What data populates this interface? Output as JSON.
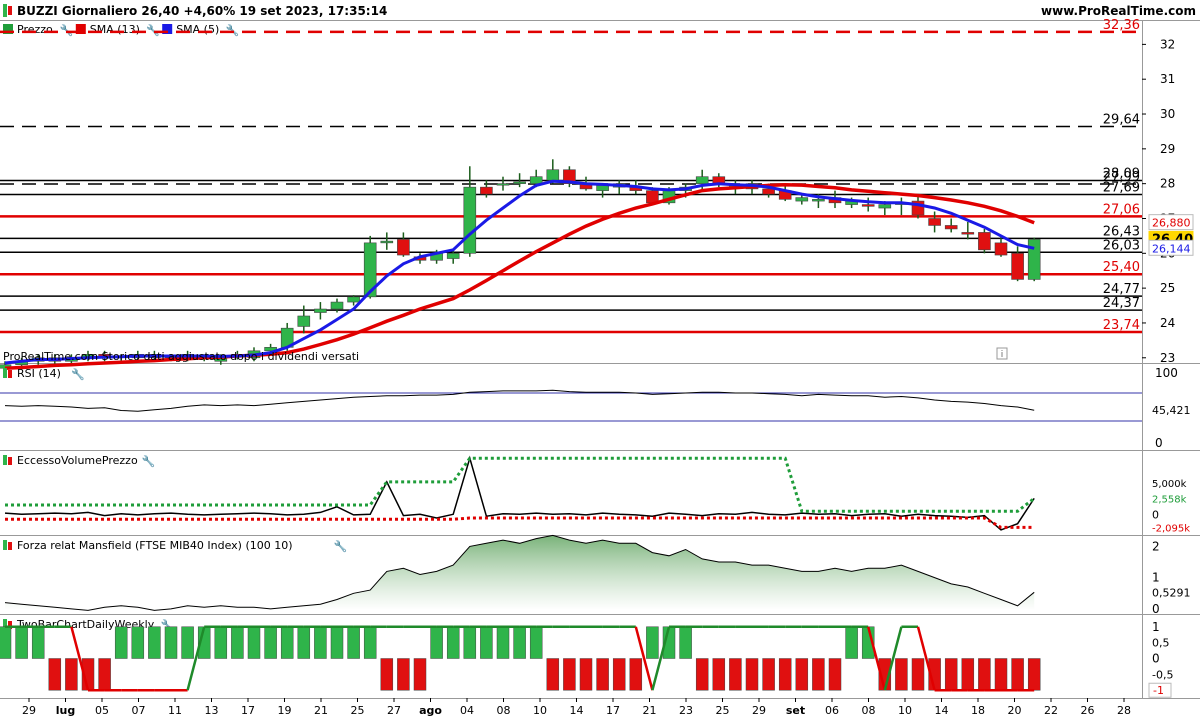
{
  "header": {
    "title": "BUZZI Giornaliero 26,40 +4,60% 19 set 2023, 17:35:14",
    "site": "www.ProRealTime.com"
  },
  "footnote": "ProRealTime.com  Storico dati aggiustato dopo i dividendi versati",
  "legend": [
    {
      "label": "Prezzo",
      "color": "#1f9d3a"
    },
    {
      "label": "SMA (13)",
      "color": "#e00000"
    },
    {
      "label": "SMA (5)",
      "color": "#1a1ae6"
    }
  ],
  "colors": {
    "up": "#2fb44a",
    "down": "#e01010",
    "sma13": "#e00000",
    "sma5": "#1a1ae6",
    "price_badge": "#ffd700"
  },
  "xaxis": {
    "labels": [
      "29",
      "lug",
      "05",
      "07",
      "11",
      "13",
      "17",
      "19",
      "21",
      "25",
      "27",
      "ago",
      "04",
      "08",
      "10",
      "14",
      "17",
      "21",
      "23",
      "25",
      "29",
      "set",
      "06",
      "08",
      "10",
      "14",
      "18",
      "20",
      "22",
      "26",
      "28"
    ]
  },
  "chart_data": [
    {
      "type": "candlestick",
      "title": "Prezzo",
      "ylim": [
        22.85,
        32.7
      ],
      "yticks": [
        23,
        24,
        25,
        26,
        27,
        28,
        29,
        30,
        31,
        32
      ],
      "levels": [
        {
          "value": 32.36,
          "label": "32,36",
          "color": "#e00000",
          "style": "dashed"
        },
        {
          "value": 29.64,
          "label": "29,64",
          "color": "#000000",
          "style": "dashed"
        },
        {
          "value": 28.09,
          "label": "28,09",
          "color": "#000000",
          "style": "solid"
        },
        {
          "value": 27.99,
          "label": "27,99",
          "color": "#000000",
          "style": "dashed"
        },
        {
          "value": 27.69,
          "label": "27,69",
          "color": "#000000",
          "style": "solid"
        },
        {
          "value": 27.06,
          "label": "27,06",
          "color": "#e00000",
          "style": "solid"
        },
        {
          "value": 26.43,
          "label": "26,43",
          "color": "#000000",
          "style": "solid"
        },
        {
          "value": 26.03,
          "label": "26,03",
          "color": "#000000",
          "style": "solid"
        },
        {
          "value": 25.4,
          "label": "25,40",
          "color": "#e00000",
          "style": "solid"
        },
        {
          "value": 24.77,
          "label": "24,77",
          "color": "#000000",
          "style": "solid"
        },
        {
          "value": 24.37,
          "label": "24,37",
          "color": "#000000",
          "style": "solid"
        },
        {
          "value": 23.74,
          "label": "23,74",
          "color": "#e00000",
          "style": "solid"
        }
      ],
      "badges": [
        {
          "value": 26.88,
          "label": "26,880",
          "color": "#e00000",
          "bg": "#ffffff"
        },
        {
          "value": 26.4,
          "label": "26,40",
          "color": "#000000",
          "bg": "#ffd700"
        },
        {
          "value": 26.144,
          "label": "26,144",
          "color": "#1a1ae6",
          "bg": "#ffffff"
        }
      ],
      "ohlc": [
        [
          22.7,
          22.9,
          22.6,
          22.8
        ],
        [
          22.8,
          23.0,
          22.7,
          22.9
        ],
        [
          22.9,
          23.1,
          22.8,
          23.0
        ],
        [
          23.0,
          23.1,
          22.8,
          22.9
        ],
        [
          22.9,
          23.1,
          22.8,
          23.0
        ],
        [
          23.0,
          23.2,
          22.9,
          23.1
        ],
        [
          23.1,
          23.2,
          22.9,
          23.0
        ],
        [
          23.0,
          23.1,
          22.9,
          23.05
        ],
        [
          23.0,
          23.2,
          22.9,
          23.1
        ],
        [
          23.1,
          23.2,
          22.9,
          23.0
        ],
        [
          23.0,
          23.1,
          22.9,
          23.05
        ],
        [
          23.0,
          23.2,
          22.9,
          23.1
        ],
        [
          23.05,
          23.1,
          22.9,
          23.0
        ],
        [
          22.9,
          23.1,
          22.8,
          23.05
        ],
        [
          23.05,
          23.2,
          22.95,
          23.1
        ],
        [
          23.0,
          23.3,
          22.9,
          23.2
        ],
        [
          23.2,
          23.4,
          23.1,
          23.3
        ],
        [
          23.3,
          24.0,
          23.2,
          23.85
        ],
        [
          23.9,
          24.5,
          23.7,
          24.2
        ],
        [
          24.3,
          24.6,
          24.1,
          24.4
        ],
        [
          24.4,
          24.7,
          24.3,
          24.6
        ],
        [
          24.6,
          24.8,
          24.5,
          24.75
        ],
        [
          24.75,
          26.5,
          24.7,
          26.3
        ],
        [
          26.3,
          26.6,
          26.1,
          26.35
        ],
        [
          26.4,
          26.6,
          25.9,
          25.95
        ],
        [
          25.9,
          26.0,
          25.7,
          25.8
        ],
        [
          25.8,
          26.1,
          25.7,
          26.0
        ],
        [
          25.85,
          26.1,
          25.7,
          26.0
        ],
        [
          26.0,
          28.5,
          25.9,
          27.9
        ],
        [
          27.9,
          28.1,
          27.6,
          27.7
        ],
        [
          28.0,
          28.2,
          27.8,
          28.0
        ],
        [
          28.0,
          28.3,
          27.9,
          28.05
        ],
        [
          28.0,
          28.4,
          27.9,
          28.2
        ],
        [
          28.1,
          28.7,
          28.0,
          28.4
        ],
        [
          28.4,
          28.5,
          27.9,
          28.0
        ],
        [
          28.0,
          28.2,
          27.8,
          27.85
        ],
        [
          27.8,
          28.0,
          27.6,
          27.95
        ],
        [
          27.9,
          28.1,
          27.7,
          28.0
        ],
        [
          27.9,
          28.1,
          27.7,
          27.8
        ],
        [
          27.8,
          27.9,
          27.4,
          27.45
        ],
        [
          27.45,
          27.9,
          27.4,
          27.85
        ],
        [
          27.8,
          28.0,
          27.6,
          27.9
        ],
        [
          28.0,
          28.4,
          27.8,
          28.2
        ],
        [
          28.2,
          28.3,
          27.9,
          28.0
        ],
        [
          27.9,
          28.1,
          27.7,
          27.95
        ],
        [
          28.0,
          28.1,
          27.7,
          27.85
        ],
        [
          27.85,
          28.0,
          27.6,
          27.7
        ],
        [
          27.8,
          28.0,
          27.5,
          27.55
        ],
        [
          27.5,
          27.7,
          27.4,
          27.6
        ],
        [
          27.5,
          27.7,
          27.3,
          27.55
        ],
        [
          27.6,
          27.8,
          27.3,
          27.45
        ],
        [
          27.4,
          27.6,
          27.3,
          27.5
        ],
        [
          27.4,
          27.6,
          27.2,
          27.35
        ],
        [
          27.3,
          27.5,
          27.1,
          27.4
        ],
        [
          27.4,
          27.6,
          27.1,
          27.45
        ],
        [
          27.5,
          27.7,
          27.0,
          27.1
        ],
        [
          27.0,
          27.2,
          26.6,
          26.8
        ],
        [
          26.8,
          27.0,
          26.6,
          26.7
        ],
        [
          26.6,
          26.9,
          26.4,
          26.55
        ],
        [
          26.6,
          26.7,
          26.0,
          26.1
        ],
        [
          26.3,
          26.5,
          25.9,
          25.95
        ],
        [
          26.0,
          26.2,
          25.2,
          25.25
        ],
        [
          25.25,
          26.45,
          25.2,
          26.4
        ]
      ],
      "sma5": [
        22.85,
        22.9,
        22.95,
        22.95,
        22.98,
        23.0,
        23.02,
        23.03,
        23.05,
        23.05,
        23.05,
        23.05,
        23.05,
        23.04,
        23.05,
        23.08,
        23.15,
        23.3,
        23.55,
        23.8,
        24.1,
        24.4,
        24.9,
        25.35,
        25.7,
        25.9,
        26.0,
        26.1,
        26.55,
        26.95,
        27.3,
        27.65,
        27.95,
        28.07,
        28.05,
        28.0,
        27.98,
        27.95,
        27.92,
        27.85,
        27.82,
        27.85,
        27.95,
        28.0,
        27.97,
        27.95,
        27.9,
        27.8,
        27.7,
        27.62,
        27.57,
        27.52,
        27.48,
        27.45,
        27.45,
        27.4,
        27.3,
        27.15,
        26.95,
        26.75,
        26.5,
        26.25,
        26.144
      ],
      "sma13": [
        22.7,
        22.72,
        22.75,
        22.78,
        22.8,
        22.83,
        22.85,
        22.87,
        22.9,
        22.92,
        22.95,
        22.97,
        23.0,
        23.02,
        23.05,
        23.07,
        23.1,
        23.15,
        23.25,
        23.38,
        23.52,
        23.68,
        23.86,
        24.05,
        24.22,
        24.4,
        24.55,
        24.7,
        24.95,
        25.22,
        25.5,
        25.78,
        26.05,
        26.3,
        26.55,
        26.78,
        26.98,
        27.15,
        27.3,
        27.42,
        27.55,
        27.68,
        27.8,
        27.85,
        27.88,
        27.92,
        27.95,
        27.97,
        27.96,
        27.92,
        27.88,
        27.82,
        27.78,
        27.74,
        27.7,
        27.66,
        27.6,
        27.53,
        27.45,
        27.35,
        27.22,
        27.06,
        26.88
      ]
    },
    {
      "type": "line",
      "title": "RSI (14)",
      "ylim": [
        0,
        100
      ],
      "yticks": [
        0,
        100
      ],
      "levels": [
        70,
        30
      ],
      "last_label": "45,421",
      "values": [
        52,
        51,
        52,
        51,
        50,
        48,
        49,
        45,
        44,
        46,
        48,
        51,
        53,
        52,
        53,
        52,
        54,
        56,
        58,
        60,
        62,
        64,
        65,
        66,
        66,
        67,
        67,
        68,
        71,
        72,
        73,
        73,
        73,
        74,
        72,
        71,
        71,
        71,
        70,
        68,
        69,
        70,
        71,
        71,
        70,
        70,
        69,
        68,
        66,
        68,
        67,
        66,
        66,
        64,
        65,
        63,
        60,
        58,
        57,
        55,
        52,
        50,
        45.421
      ],
      "color": "#000000"
    },
    {
      "type": "line",
      "title": "EccessoVolumePrezzo",
      "ylim": [
        -3000,
        10000
      ],
      "yticks": [
        0
      ],
      "tick_labels": [
        {
          "value": 5000,
          "label": "5,000k"
        }
      ],
      "last_labels": [
        {
          "value": 2558,
          "label": "2,558k",
          "color": "#1f9d3a"
        },
        {
          "value": -2095,
          "label": "-2,095k",
          "color": "#e00000"
        }
      ],
      "series": [
        {
          "values": [
            200,
            0,
            100,
            200,
            100,
            300,
            -200,
            100,
            -100,
            100,
            200,
            0,
            -100,
            0,
            100,
            200,
            100,
            -100,
            0,
            300,
            1200,
            -100,
            0,
            5200,
            -200,
            0,
            -600,
            0,
            9000,
            -300,
            100,
            0,
            200,
            0,
            100,
            -100,
            200,
            0,
            -100,
            -300,
            200,
            0,
            -200,
            100,
            0,
            300,
            0,
            -100,
            200,
            0,
            100,
            -200,
            0,
            100,
            -300,
            0,
            -200,
            -300,
            -500,
            -200,
            -2500,
            -1500,
            2558
          ],
          "color": "#000000",
          "style": "solid"
        },
        {
          "values": [
            1500,
            1500,
            1500,
            1500,
            1500,
            1500,
            1500,
            1500,
            1500,
            1500,
            1500,
            1500,
            1500,
            1500,
            1500,
            1500,
            1500,
            1500,
            1500,
            1500,
            1500,
            1500,
            1500,
            5200,
            5200,
            5200,
            5200,
            5200,
            9000,
            9000,
            9000,
            9000,
            9000,
            9000,
            9000,
            9000,
            9000,
            9000,
            9000,
            9000,
            9000,
            9000,
            9000,
            9000,
            9000,
            9000,
            9000,
            9000,
            500,
            500,
            500,
            500,
            500,
            500,
            500,
            500,
            500,
            500,
            500,
            500,
            500,
            500,
            2558
          ],
          "color": "#1f9d3a",
          "style": "dotted"
        },
        {
          "values": [
            -800,
            -800,
            -800,
            -800,
            -800,
            -800,
            -800,
            -800,
            -800,
            -800,
            -800,
            -800,
            -800,
            -800,
            -800,
            -800,
            -800,
            -800,
            -800,
            -800,
            -800,
            -800,
            -800,
            -800,
            -800,
            -800,
            -800,
            -800,
            -600,
            -600,
            -600,
            -600,
            -600,
            -600,
            -600,
            -600,
            -600,
            -600,
            -600,
            -600,
            -600,
            -600,
            -600,
            -600,
            -600,
            -600,
            -600,
            -600,
            -600,
            -600,
            -600,
            -600,
            -600,
            -600,
            -600,
            -600,
            -600,
            -600,
            -600,
            -600,
            -2095,
            -2095,
            -2095
          ],
          "color": "#e00000",
          "style": "dotted"
        }
      ]
    },
    {
      "type": "area",
      "title": "Forza relat Mansfield (FTSE MIB40 Index) (100 10)",
      "ylim": [
        -0.1,
        2.3
      ],
      "yticks": [
        0,
        1,
        2
      ],
      "last_label": "0,5291",
      "values": [
        0.2,
        0.15,
        0.1,
        0.05,
        0,
        -0.05,
        0.05,
        0.1,
        0.05,
        -0.05,
        0,
        0.1,
        0.05,
        0.1,
        0.05,
        0.05,
        0,
        0.05,
        0.1,
        0.15,
        0.3,
        0.5,
        0.6,
        1.2,
        1.3,
        1.1,
        1.2,
        1.4,
        2.0,
        2.1,
        2.2,
        2.1,
        2.25,
        2.35,
        2.2,
        2.1,
        2.2,
        2.1,
        2.1,
        1.8,
        1.7,
        1.9,
        1.6,
        1.5,
        1.5,
        1.4,
        1.4,
        1.3,
        1.2,
        1.2,
        1.3,
        1.2,
        1.3,
        1.3,
        1.4,
        1.2,
        1.0,
        0.8,
        0.7,
        0.5,
        0.3,
        0.1,
        0.5291
      ],
      "color": "#8fc48f"
    },
    {
      "type": "bar",
      "title": "TwoBarChartDailyWeekly",
      "ylim": [
        -1.15,
        1.15
      ],
      "yticks": [
        1,
        0,
        -1
      ],
      "tick_labels": [
        {
          "value": 0.5,
          "label": "0,5"
        },
        {
          "value": -0.5,
          "label": "-0,5"
        }
      ],
      "last_label": "-1",
      "values": [
        1,
        1,
        1,
        -1,
        -1,
        -1,
        -1,
        1,
        1,
        1,
        1,
        1,
        1,
        1,
        1,
        1,
        1,
        1,
        1,
        1,
        1,
        1,
        1,
        -1,
        -1,
        -1,
        1,
        1,
        1,
        1,
        1,
        1,
        1,
        -1,
        -1,
        -1,
        -1,
        -1,
        -1,
        1,
        1,
        1,
        -1,
        -1,
        -1,
        -1,
        -1,
        -1,
        -1,
        -1,
        -1,
        1,
        1,
        -1,
        -1,
        -1,
        -1,
        -1,
        -1,
        -1,
        -1,
        -1,
        -1
      ],
      "line": [
        1,
        1,
        1,
        1,
        1,
        -1,
        -1,
        -1,
        -1,
        -1,
        -1,
        -1,
        1,
        1,
        1,
        1,
        1,
        1,
        1,
        1,
        1,
        1,
        1,
        1,
        1,
        1,
        1,
        1,
        1,
        1,
        1,
        1,
        1,
        1,
        1,
        1,
        1,
        1,
        1,
        -1,
        1,
        1,
        1,
        1,
        1,
        1,
        1,
        1,
        1,
        1,
        1,
        1,
        1,
        -1,
        1,
        1,
        -1,
        -1,
        -1,
        -1,
        -1,
        -1,
        -1
      ]
    }
  ]
}
